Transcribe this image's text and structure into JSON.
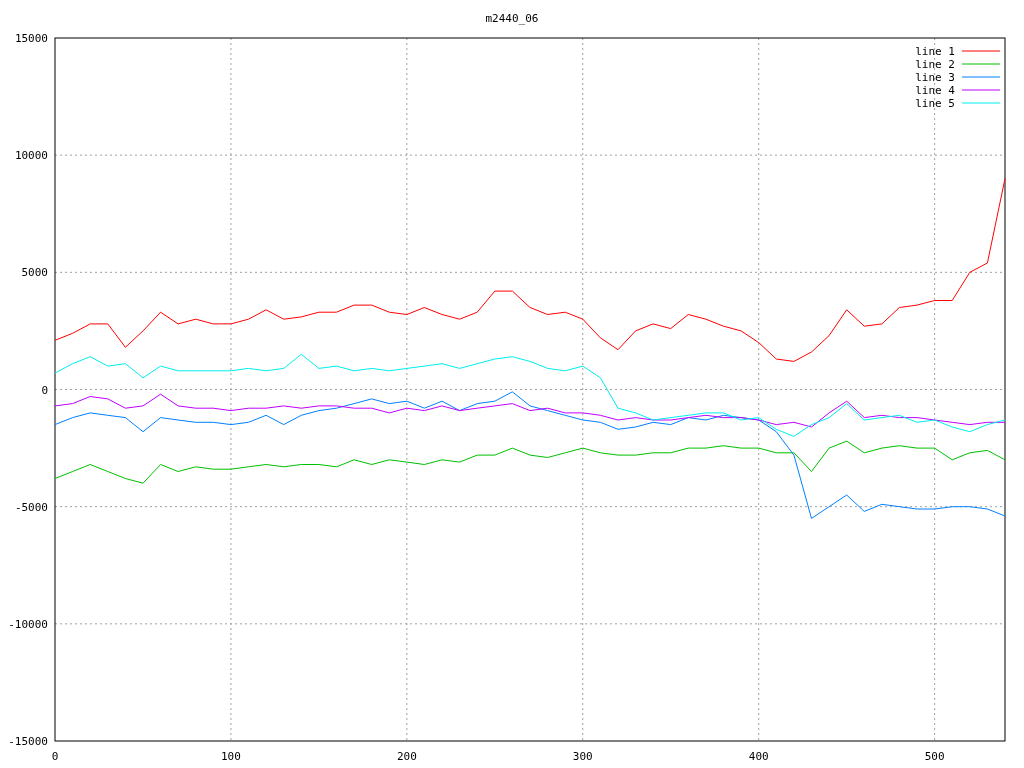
{
  "chart": {
    "chart_data": {
      "type": "line",
      "title": "m2440_06",
      "x": [
        0,
        10,
        20,
        30,
        40,
        50,
        60,
        70,
        80,
        90,
        100,
        110,
        120,
        130,
        140,
        150,
        160,
        170,
        180,
        190,
        200,
        210,
        220,
        230,
        240,
        250,
        260,
        270,
        280,
        290,
        300,
        310,
        320,
        330,
        340,
        350,
        360,
        370,
        380,
        390,
        400,
        410,
        420,
        430,
        440,
        450,
        460,
        470,
        480,
        490,
        500,
        510,
        520,
        530,
        540
      ],
      "series": [
        {
          "name": "line 1",
          "color": "#ff0000",
          "values": [
            2100,
            2400,
            2800,
            2800,
            1800,
            2500,
            3300,
            2800,
            3000,
            2800,
            2800,
            3000,
            3400,
            3000,
            3100,
            3300,
            3300,
            3600,
            3600,
            3300,
            3200,
            3500,
            3200,
            3000,
            3300,
            4200,
            4200,
            3500,
            3200,
            3300,
            3000,
            2200,
            1700,
            2500,
            2800,
            2600,
            3200,
            3000,
            2700,
            2500,
            2000,
            1300,
            1200,
            1600,
            2300,
            3400,
            2700,
            2800,
            3500,
            3600,
            3800,
            3800,
            5000,
            5400,
            9000
          ]
        },
        {
          "name": "line 2",
          "color": "#00c000",
          "values": [
            -3800,
            -3500,
            -3200,
            -3500,
            -3800,
            -4000,
            -3200,
            -3500,
            -3300,
            -3400,
            -3400,
            -3300,
            -3200,
            -3300,
            -3200,
            -3200,
            -3300,
            -3000,
            -3200,
            -3000,
            -3100,
            -3200,
            -3000,
            -3100,
            -2800,
            -2800,
            -2500,
            -2800,
            -2900,
            -2700,
            -2500,
            -2700,
            -2800,
            -2800,
            -2700,
            -2700,
            -2500,
            -2500,
            -2400,
            -2500,
            -2500,
            -2700,
            -2700,
            -3500,
            -2500,
            -2200,
            -2700,
            -2500,
            -2400,
            -2500,
            -2500,
            -3000,
            -2700,
            -2600,
            -3000
          ]
        },
        {
          "name": "line 3",
          "color": "#0080ff",
          "values": [
            -1500,
            -1200,
            -1000,
            -1100,
            -1200,
            -1800,
            -1200,
            -1300,
            -1400,
            -1400,
            -1500,
            -1400,
            -1100,
            -1500,
            -1100,
            -900,
            -800,
            -600,
            -400,
            -600,
            -500,
            -800,
            -500,
            -900,
            -600,
            -500,
            -100,
            -700,
            -900,
            -1100,
            -1300,
            -1400,
            -1700,
            -1600,
            -1400,
            -1500,
            -1200,
            -1300,
            -1100,
            -1200,
            -1300,
            -1800,
            -2800,
            -5500,
            -5000,
            -4500,
            -5200,
            -4900,
            -5000,
            -5100,
            -5100,
            -5000,
            -5000,
            -5100,
            -5400
          ]
        },
        {
          "name": "line 4",
          "color": "#c000ff",
          "values": [
            -700,
            -600,
            -300,
            -400,
            -800,
            -700,
            -200,
            -700,
            -800,
            -800,
            -900,
            -800,
            -800,
            -700,
            -800,
            -700,
            -700,
            -800,
            -800,
            -1000,
            -800,
            -900,
            -700,
            -900,
            -800,
            -700,
            -600,
            -900,
            -800,
            -1000,
            -1000,
            -1100,
            -1300,
            -1200,
            -1300,
            -1300,
            -1200,
            -1100,
            -1200,
            -1200,
            -1300,
            -1500,
            -1400,
            -1600,
            -1000,
            -500,
            -1200,
            -1100,
            -1200,
            -1200,
            -1300,
            -1400,
            -1500,
            -1400,
            -1400
          ]
        },
        {
          "name": "line 5",
          "color": "#00eeee",
          "values": [
            700,
            1100,
            1400,
            1000,
            1100,
            500,
            1000,
            800,
            800,
            800,
            800,
            900,
            800,
            900,
            1500,
            900,
            1000,
            800,
            900,
            800,
            900,
            1000,
            1100,
            900,
            1100,
            1300,
            1400,
            1200,
            900,
            800,
            1000,
            500,
            -800,
            -1000,
            -1300,
            -1200,
            -1100,
            -1000,
            -1000,
            -1300,
            -1200,
            -1700,
            -2000,
            -1500,
            -1200,
            -600,
            -1300,
            -1200,
            -1100,
            -1400,
            -1300,
            -1600,
            -1800,
            -1500,
            -1300
          ]
        }
      ],
      "xlim": [
        0,
        540
      ],
      "ylim": [
        -15000,
        15000
      ],
      "xticks": [
        0,
        100,
        200,
        300,
        400,
        500
      ],
      "yticks": [
        -15000,
        -10000,
        -5000,
        0,
        5000,
        10000,
        15000
      ],
      "grid": true,
      "legend": true
    }
  }
}
